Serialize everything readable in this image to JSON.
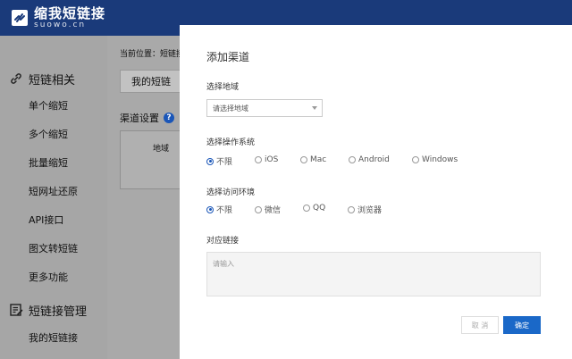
{
  "header": {
    "logo_cn": "缩我短链接",
    "logo_en": "suowo.cn"
  },
  "sidebar": {
    "groups": [
      {
        "title": "短链相关",
        "icon": "link-icon"
      },
      {
        "title": "短链接管理",
        "icon": "edit-list-icon"
      }
    ],
    "items": [
      "单个缩短",
      "多个缩短",
      "批量缩短",
      "短网址还原",
      "API接口",
      "图文转短链",
      "更多功能",
      "我的短链接"
    ]
  },
  "content": {
    "breadcrumb": "当前位置：短链接",
    "tab_label": "我的短链",
    "channel_settings": "渠道设置",
    "table_header": "地域"
  },
  "modal": {
    "title": "添加渠道",
    "region": {
      "label": "选择地域",
      "placeholder": "请选择地域"
    },
    "os": {
      "label": "选择操作系统",
      "options": [
        "不限",
        "iOS",
        "Mac",
        "Android",
        "Windows"
      ],
      "selected": "不限"
    },
    "env": {
      "label": "选择访问环境",
      "options": [
        "不限",
        "微信",
        "QQ",
        "浏览器"
      ],
      "selected": "不限"
    },
    "link": {
      "label": "对应链接",
      "placeholder": "请输入"
    },
    "cancel_label": "取 消",
    "ok_label": "确定"
  },
  "colors": {
    "header": "#1a3a7a",
    "primary": "#1a68c8",
    "overlay": "#a9a9a9"
  }
}
